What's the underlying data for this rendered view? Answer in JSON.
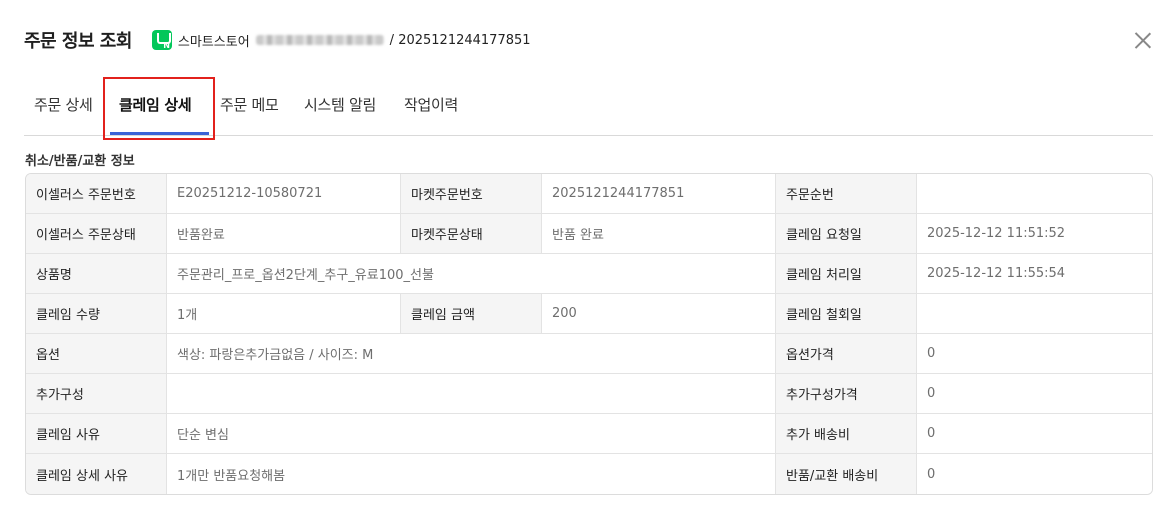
{
  "header": {
    "title": "주문 정보 조회",
    "store_name": "스마트스토어",
    "separator": "/",
    "order_number": "2025121244177851"
  },
  "colors": {
    "brand_store": "#03c75a",
    "tab_active": "#3a63d6",
    "highlight": "#e2211c"
  },
  "tabs": [
    {
      "label": "주문 상세"
    },
    {
      "label": "클레임 상세",
      "active": true
    },
    {
      "label": "주문 메모"
    },
    {
      "label": "시스템 알림"
    },
    {
      "label": "작업이력"
    }
  ],
  "section": {
    "title": "취소/반품/교환 정보"
  },
  "table": {
    "rows": [
      [
        {
          "label": "이셀러스 주문번호",
          "value": "E20251212-10580721"
        },
        {
          "label": "마켓주문번호",
          "value": "2025121244177851"
        },
        {
          "label": "주문순번",
          "value": ""
        }
      ],
      [
        {
          "label": "이셀러스 주문상태",
          "value": "반품완료"
        },
        {
          "label": "마켓주문상태",
          "value": "반품 완료"
        },
        {
          "label": "클레임 요청일",
          "value": "2025-12-12 11:51:52"
        }
      ],
      [
        {
          "label": "상품명",
          "value": "주문관리_프로_옵션2단계_추구_유료100_선불"
        },
        {
          "label": "클레임 처리일",
          "value": "2025-12-12 11:55:54"
        }
      ],
      [
        {
          "label": "클레임 수량",
          "value": "1개"
        },
        {
          "label": "클레임 금액",
          "value": "200"
        },
        {
          "label": "클레임 철회일",
          "value": ""
        }
      ],
      [
        {
          "label": "옵션",
          "value": "색상: 파랑은추가금없음 / 사이즈: M"
        },
        {
          "label": "옵션가격",
          "value": "0"
        }
      ],
      [
        {
          "label": "추가구성",
          "value": ""
        },
        {
          "label": "추가구성가격",
          "value": "0"
        }
      ],
      [
        {
          "label": "클레임 사유",
          "value": "단순 변심"
        },
        {
          "label": "추가 배송비",
          "value": "0"
        }
      ],
      [
        {
          "label": "클레임 상세 사유",
          "value": "1개만 반품요청해봄"
        },
        {
          "label": "반품/교환 배송비",
          "value": "0"
        }
      ]
    ]
  }
}
